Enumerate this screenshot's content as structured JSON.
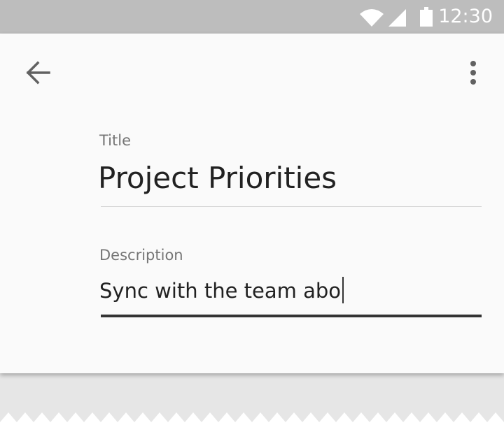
{
  "status_bar": {
    "time": "12:30",
    "icons": [
      "wifi-icon",
      "cell-signal-icon",
      "battery-icon"
    ],
    "background": "#bdbdbd"
  },
  "toolbar": {
    "back_icon": "arrow-back-icon",
    "menu_icon": "more-vert-icon"
  },
  "form": {
    "title_label": "Title",
    "title_value": "Project Priorities",
    "description_label": "Description",
    "description_value": "Sync with the team abo"
  },
  "colors": {
    "card_background": "#fafafa",
    "text_primary": "#212121",
    "text_secondary": "#757575",
    "focused_underline": "#333333"
  }
}
